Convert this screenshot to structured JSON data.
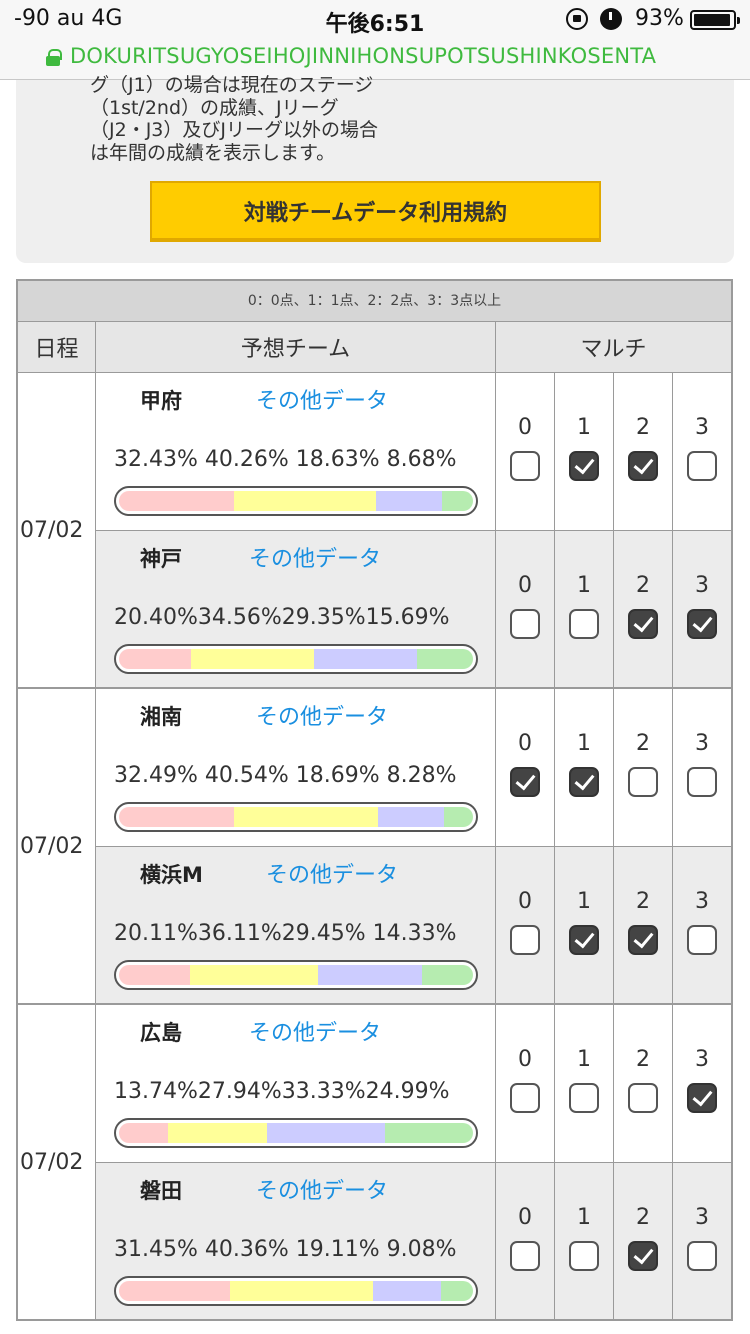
{
  "status_bar": {
    "carrier": "-90  au    4G",
    "time": "午後6:51",
    "battery": "93%"
  },
  "url": "DOKURITSUGYOSEIHOJINNIHONSUPOTSUSHINKOSENTA",
  "notice": {
    "lines": [
      "グ（J1）の場合は現在のステージ",
      "（1st/2nd）の成績、Jリーグ",
      "（J2・J3）及びJリーグ以外の場合",
      "は年間の成績を表示します。"
    ],
    "button": "対戦チームデータ利用規約"
  },
  "table": {
    "legend": "0：0点、1：1点、2：2点、3：3点以上",
    "headers": {
      "date": "日程",
      "team": "予想チーム",
      "multi": "マルチ"
    },
    "other_label": "その他データ",
    "matches": [
      {
        "date": "07/02",
        "teams": [
          {
            "name": "甲府",
            "pcts": [
              32.43,
              40.26,
              18.63,
              8.68
            ],
            "pct_text": "32.43% 40.26% 18.63% 8.68%",
            "checks": [
              false,
              true,
              true,
              false
            ]
          },
          {
            "name": "神戸",
            "pcts": [
              20.4,
              34.56,
              29.35,
              15.69
            ],
            "pct_text": "20.40%34.56%29.35%15.69%",
            "checks": [
              false,
              false,
              true,
              true
            ]
          }
        ]
      },
      {
        "date": "07/02",
        "teams": [
          {
            "name": "湘南",
            "pcts": [
              32.49,
              40.54,
              18.69,
              8.28
            ],
            "pct_text": "32.49% 40.54% 18.69% 8.28%",
            "checks": [
              true,
              true,
              false,
              false
            ]
          },
          {
            "name": "横浜M",
            "pcts": [
              20.11,
              36.11,
              29.45,
              14.33
            ],
            "pct_text": "20.11%36.11%29.45% 14.33%",
            "checks": [
              false,
              true,
              true,
              false
            ]
          }
        ]
      },
      {
        "date": "07/02",
        "teams": [
          {
            "name": "広島",
            "pcts": [
              13.74,
              27.94,
              33.33,
              24.99
            ],
            "pct_text": "13.74%27.94%33.33%24.99%",
            "checks": [
              false,
              false,
              false,
              true
            ]
          },
          {
            "name": "磐田",
            "pcts": [
              31.45,
              40.36,
              19.11,
              9.08
            ],
            "pct_text": "31.45% 40.36% 19.11% 9.08%",
            "checks": [
              false,
              false,
              true,
              false
            ]
          }
        ]
      }
    ],
    "multi_numbers": [
      "0",
      "1",
      "2",
      "3"
    ]
  },
  "colors": {
    "url_green": "#3fba3f",
    "button_yellow": "#ffcc00",
    "link_blue": "#1a8fe0",
    "bar": [
      "#ffcccc",
      "#ffff99",
      "#ccccff",
      "#b6ecb0"
    ]
  }
}
